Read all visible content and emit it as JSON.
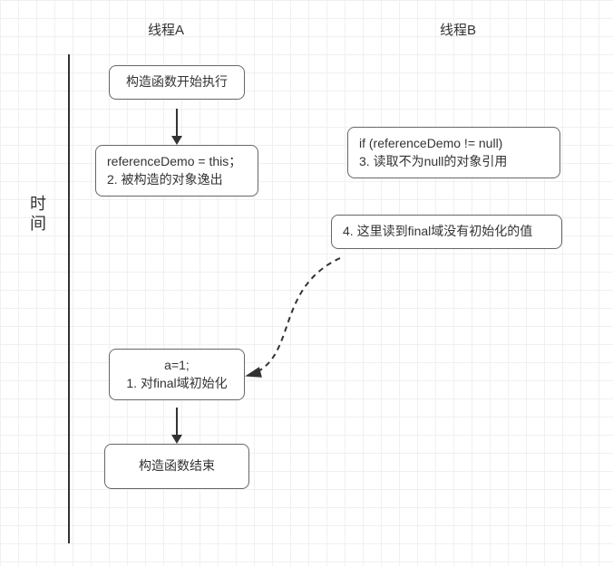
{
  "diagram": {
    "threadA_label": "线程A",
    "threadB_label": "线程B",
    "timeline_label": "时间",
    "boxes": {
      "ctor_start": "构造函数开始执行",
      "escape_line1": "referenceDemo = this；",
      "escape_line2": "2. 被构造的对象逸出",
      "threadB_read_line1": " if (referenceDemo != null)",
      "threadB_read_line2": "3. 读取不为null的对象引用",
      "threadB_final_uninit": "4. 这里读到final域没有初始化的值",
      "final_init_line1": "a=1;",
      "final_init_line2": "1. 对final域初始化",
      "ctor_end": "构造函数结束"
    }
  }
}
